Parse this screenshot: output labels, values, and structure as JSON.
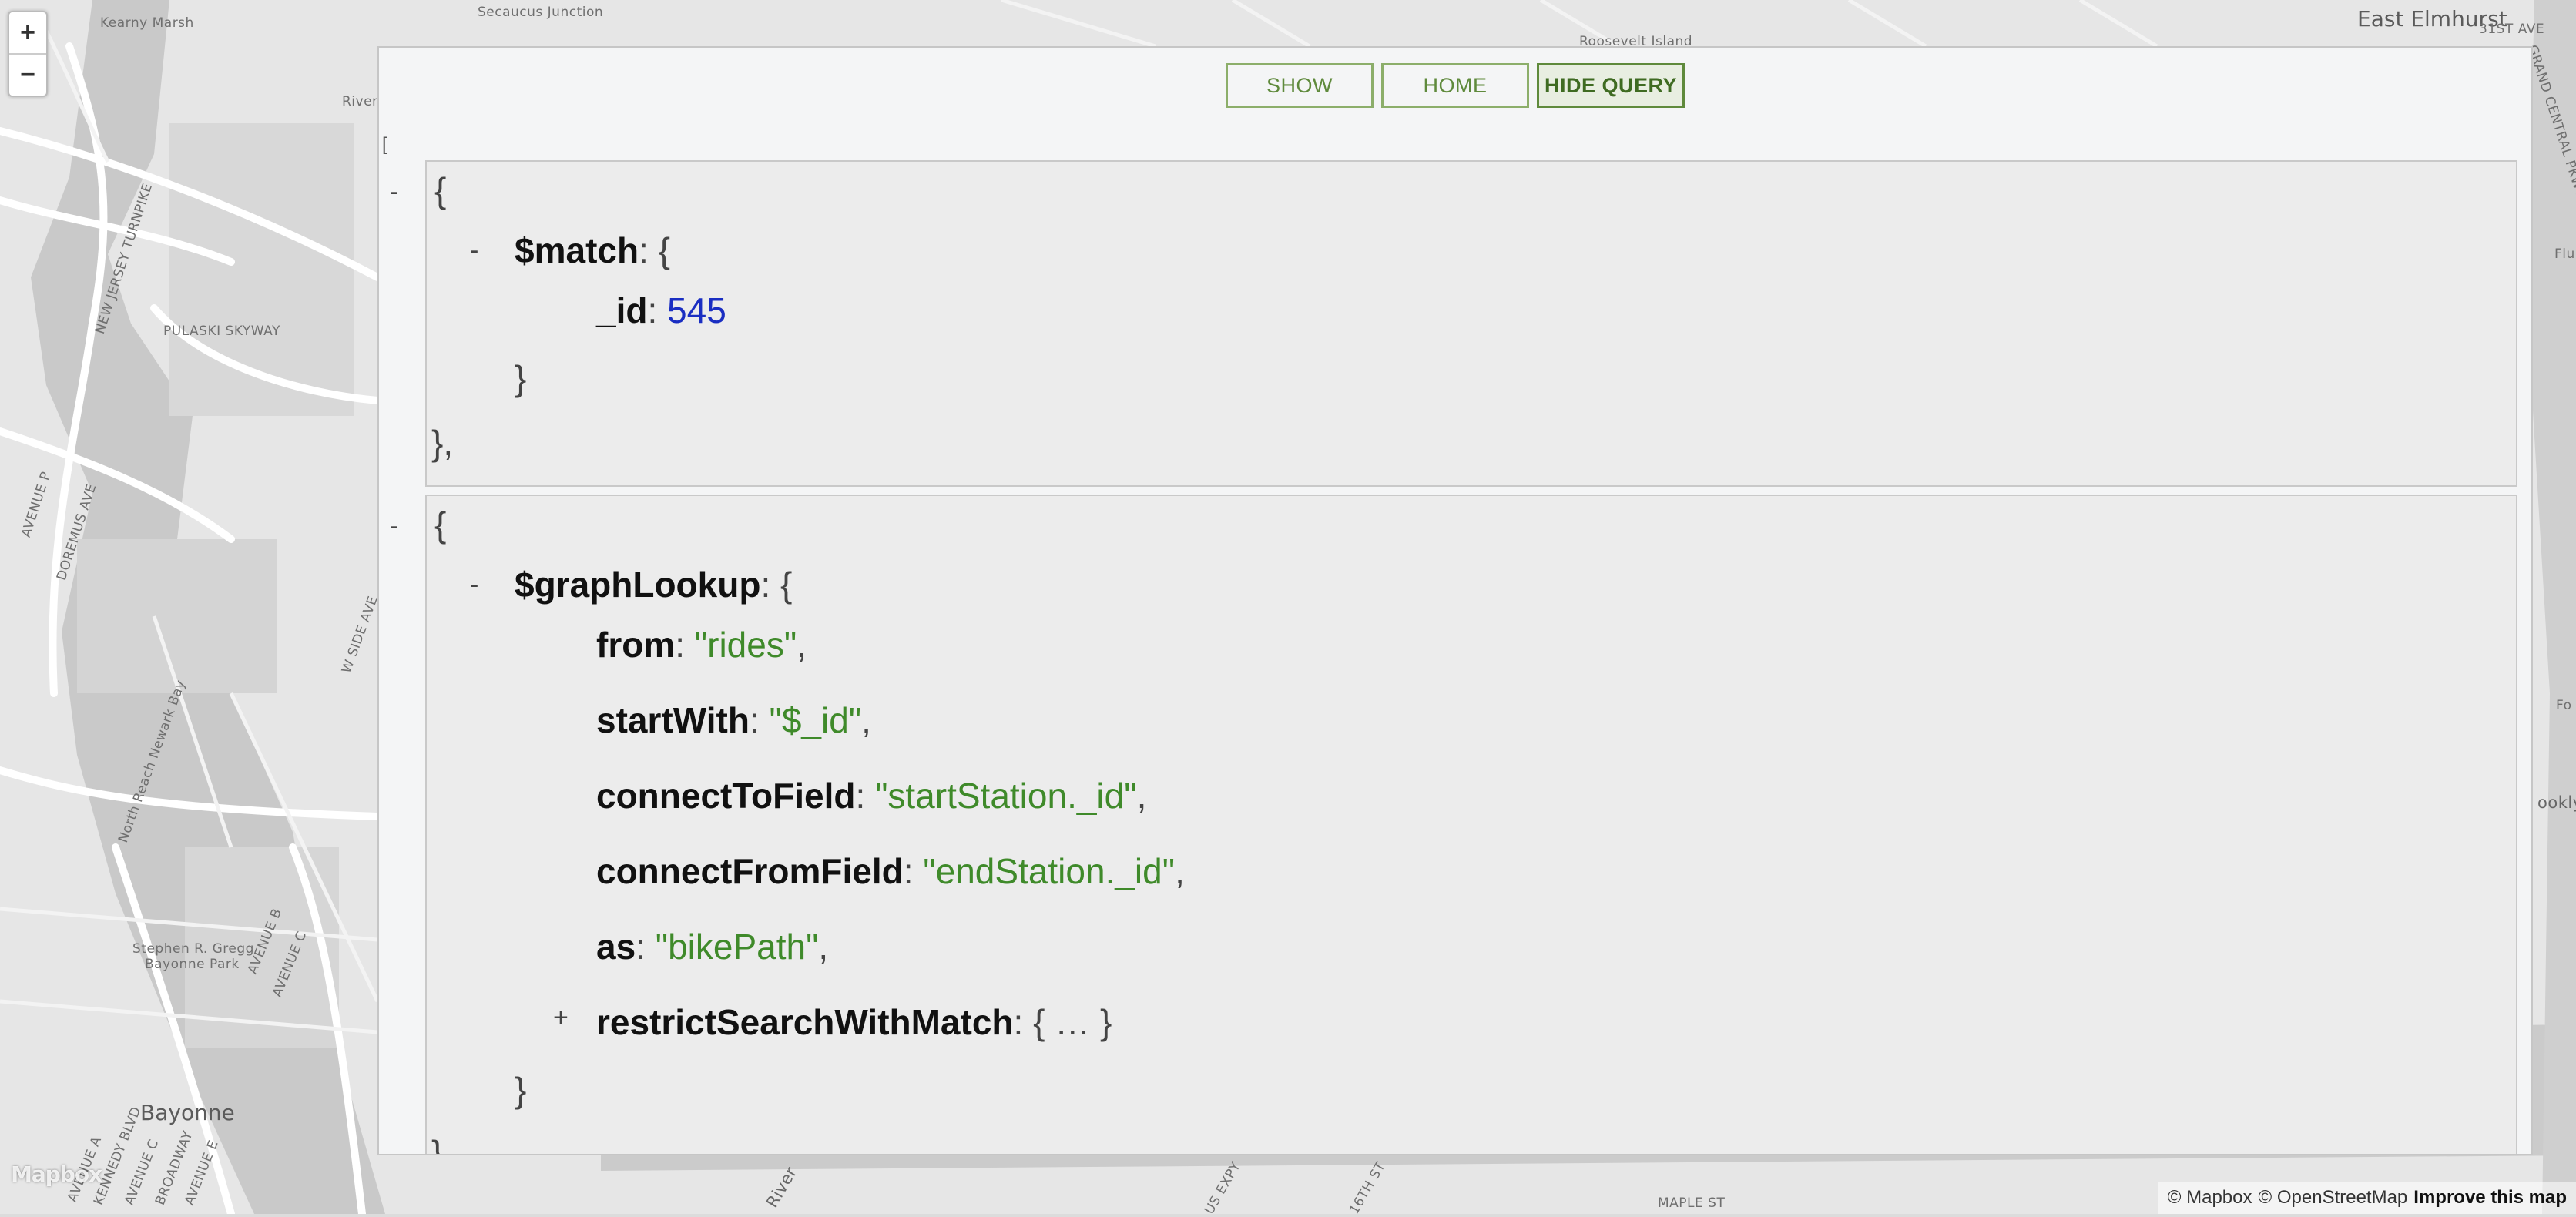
{
  "map": {
    "labels": {
      "kearny_marsh": "Kearny Marsh",
      "secaucus_junction": "Secaucus Junction",
      "roosevelt_island": "Roosevelt Island",
      "east_elmhurst": "East Elmhurst",
      "river": "River",
      "nj_turnpike": "NEW JERSEY TURNPIKE",
      "pulaski_skyway": "PULASKI SKYWAY",
      "avenue_p": "AVENUE P",
      "doremus_ave": "DOREMUS AVE",
      "w_side_ave": "W SIDE AVE",
      "north_reach": "North Reach Newark Bay",
      "avenue_b": "AVENUE B",
      "avenue_c": "AVENUE C",
      "stephen_gregg": "Stephen R. Gregg",
      "bayonne_park": "Bayonne Park",
      "bayonne": "Bayonne",
      "avenue_a": "AVENUE A",
      "kennedy_blvd": "KENNEDY BLVD",
      "avenue_c2": "AVENUE C",
      "broadway": "BROADWAY",
      "avenue_e": "AVENUE E",
      "river2": "River",
      "st_31": "31ST AVE",
      "grand_central": "GRAND CENTRAL PKWY",
      "flu": "Flu",
      "fo": "Fo",
      "brookly": "ookly",
      "maple_st": "MAPLE ST",
      "us_expy": "US EXPY",
      "st_16": "16TH ST"
    },
    "zoom_in": "+",
    "zoom_out": "−",
    "logo": "Mapbox",
    "attribution": {
      "mapbox": "© Mapbox",
      "osm": "© OpenStreetMap",
      "improve": "Improve this map"
    }
  },
  "panel": {
    "buttons": {
      "show": "SHOW",
      "home": "HOME",
      "hide_query": "HIDE QUERY"
    },
    "open_bracket": "[",
    "stage1": {
      "toggle": "-",
      "open_brace": "{",
      "inner_toggle": "-",
      "op": "$match",
      "op_open": ": {",
      "field_key": "_id",
      "field_colon": ": ",
      "field_value": "545",
      "inner_close": "}",
      "close": "},"
    },
    "stage2": {
      "toggle": "-",
      "open_brace": "{",
      "inner_toggle": "-",
      "op": "$graphLookup",
      "op_open": ": {",
      "fields": [
        {
          "key": "from",
          "value": "\"rides\"",
          "suffix": ","
        },
        {
          "key": "startWith",
          "value": "\"$_id\"",
          "suffix": ","
        },
        {
          "key": "connectToField",
          "value": "\"startStation._id\"",
          "suffix": ","
        },
        {
          "key": "connectFromField",
          "value": "\"endStation._id\"",
          "suffix": ","
        },
        {
          "key": "as",
          "value": "\"bikePath\"",
          "suffix": ","
        }
      ],
      "collapsed_toggle": "+",
      "collapsed_key": "restrictSearchWithMatch",
      "collapsed_value": ": { … }",
      "inner_close": "}",
      "close": "}"
    }
  },
  "colors": {
    "accent_green": "#5f8a3c",
    "string_green": "#3f8a2a",
    "number_blue": "#1a2ec2"
  }
}
